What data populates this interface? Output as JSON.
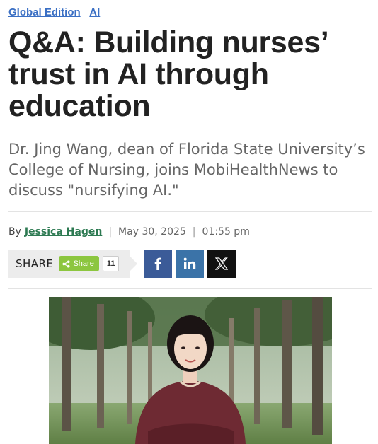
{
  "breadcrumbs": [
    "Global Edition",
    "AI"
  ],
  "article": {
    "headline": "Q&A: Building nurses’ trust in AI through education",
    "subheadline": "Dr. Jing Wang, dean of Florida State University’s College of Nursing, joins MobiHealthNews to discuss \"nursifying AI.\"",
    "by_label": "By",
    "author": "Jessica Hagen",
    "date": "May 30, 2025",
    "time": "01:55 pm"
  },
  "share": {
    "label": "SHARE",
    "button_label": "Share",
    "count": "11",
    "networks": [
      {
        "name": "facebook",
        "icon": "facebook-icon",
        "color": "#3b5b98"
      },
      {
        "name": "linkedin",
        "icon": "linkedin-icon",
        "color": "#3b73a8"
      },
      {
        "name": "x",
        "icon": "x-icon",
        "color": "#111111"
      }
    ]
  },
  "colors": {
    "link": "#3a6fc4",
    "author": "#2d7a52",
    "share_button": "#8cc63f"
  }
}
